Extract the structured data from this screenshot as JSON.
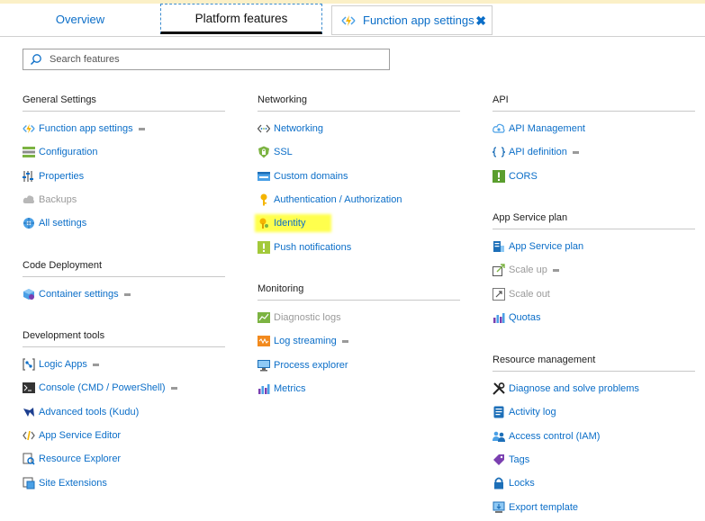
{
  "tabs": {
    "overview": "Overview",
    "platform": "Platform features",
    "function_app_settings": "Function app settings",
    "close": "✖"
  },
  "search": {
    "placeholder": "Search features"
  },
  "sections": {
    "general": {
      "title": "General Settings",
      "items": [
        "Function app settings",
        "Configuration",
        "Properties",
        "Backups",
        "All settings"
      ]
    },
    "code_deployment": {
      "title": "Code Deployment",
      "items": [
        "Container settings"
      ]
    },
    "dev_tools": {
      "title": "Development tools",
      "items": [
        "Logic Apps",
        "Console (CMD / PowerShell)",
        "Advanced tools (Kudu)",
        "App Service Editor",
        "Resource Explorer",
        "Site Extensions"
      ]
    },
    "networking": {
      "title": "Networking",
      "items": [
        "Networking",
        "SSL",
        "Custom domains",
        "Authentication / Authorization",
        "Identity",
        "Push notifications"
      ]
    },
    "monitoring": {
      "title": "Monitoring",
      "items": [
        "Diagnostic logs",
        "Log streaming",
        "Process explorer",
        "Metrics"
      ]
    },
    "api": {
      "title": "API",
      "items": [
        "API Management",
        "API definition",
        "CORS"
      ]
    },
    "app_service_plan": {
      "title": "App Service plan",
      "items": [
        "App Service plan",
        "Scale up",
        "Scale out",
        "Quotas"
      ]
    },
    "resource_management": {
      "title": "Resource management",
      "items": [
        "Diagnose and solve problems",
        "Activity log",
        "Access control (IAM)",
        "Tags",
        "Locks",
        "Export template"
      ]
    }
  },
  "colors": {
    "link": "#0b6ec8",
    "disabled": "#9a9a9a",
    "highlight": "#ffff4d"
  }
}
